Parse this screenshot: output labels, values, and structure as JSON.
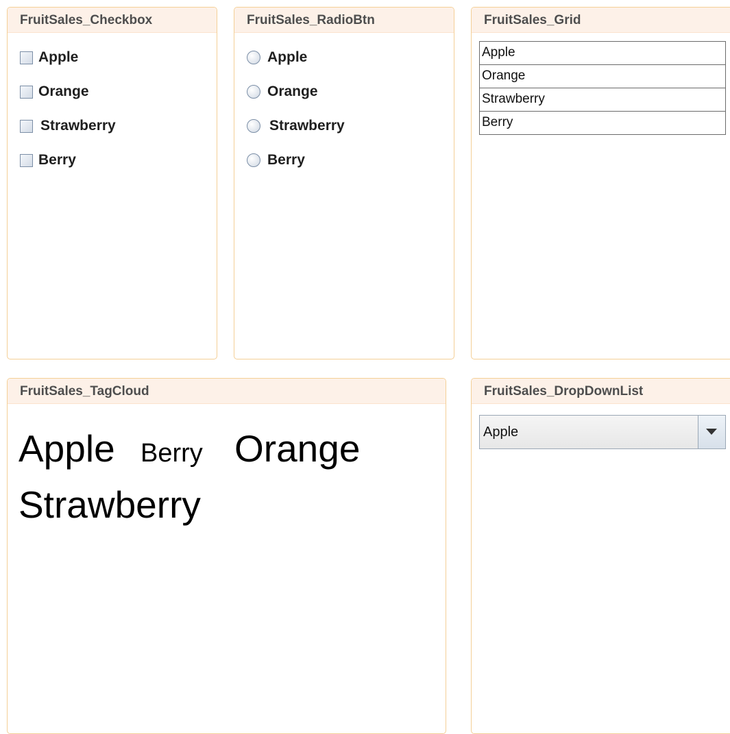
{
  "checkbox_panel": {
    "title": "FruitSales_Checkbox",
    "items": [
      "Apple",
      "Orange",
      "Strawberry",
      "Berry"
    ]
  },
  "radio_panel": {
    "title": "FruitSales_RadioBtn",
    "items": [
      "Apple",
      "Orange",
      "Strawberry",
      "Berry"
    ]
  },
  "grid_panel": {
    "title": "FruitSales_Grid",
    "rows": [
      "Apple",
      "Orange",
      "Strawberry",
      "Berry"
    ]
  },
  "tagcloud_panel": {
    "title": "FruitSales_TagCloud",
    "tags": [
      "Apple",
      "Berry",
      "Orange",
      "Strawberry"
    ]
  },
  "dropdown_panel": {
    "title": "FruitSales_DropDownList",
    "selected": "Apple"
  },
  "colors": {
    "panel_border": "#f4cf96",
    "header_bg": "#fdf1e8",
    "header_text": "#4e4e4e"
  },
  "icons": {
    "dropdown": "chevron-down-icon",
    "checkbox": "checkbox-icon",
    "radio": "radio-icon"
  }
}
